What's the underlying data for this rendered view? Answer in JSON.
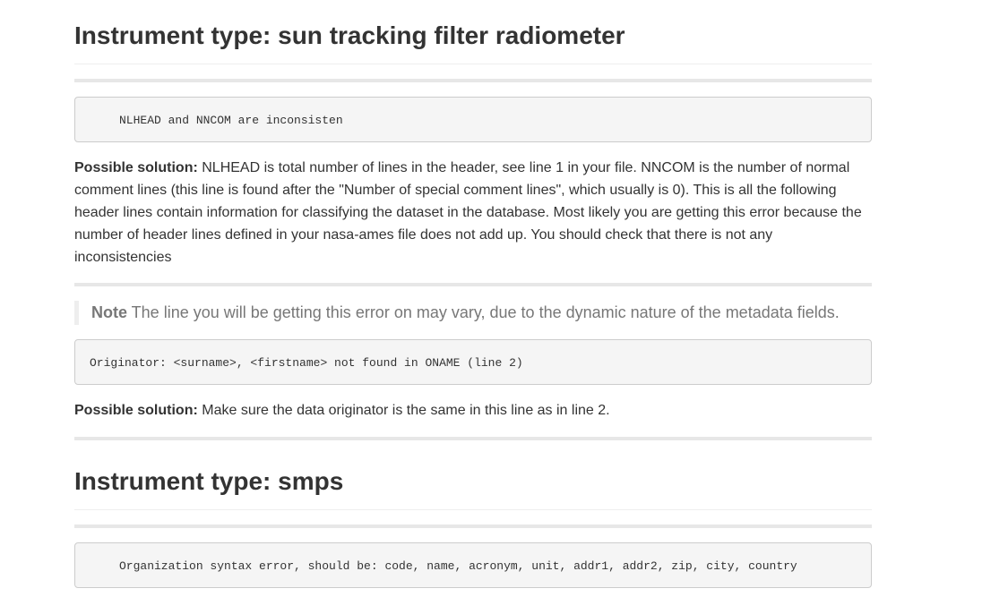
{
  "section1": {
    "heading": "Instrument type: sun tracking filter radiometer",
    "code1": "NLHEAD and NNCOM are inconsisten",
    "solution1_label": "Possible solution:",
    "solution1_text": " NLHEAD is total number of lines in the header, see line 1 in your file. NNCOM is the number of normal comment lines (this line is found after the \"Number of special comment lines\", which usually is 0). This is all the following header lines contain information for classifying the dataset in the database. Most likely you are getting this error because the number of header lines defined in your nasa-ames file does not add up. You should check that there is not any inconsistencies",
    "note_label": "Note",
    "note_text": " The line you will be getting this error on may vary, due to the dynamic nature of the metadata fields.",
    "code2": "Originator: <surname>, <firstname> not found in ONAME (line 2)",
    "solution2_label": "Possible solution:",
    "solution2_text": " Make sure the data originator is the same in this line as in line 2."
  },
  "section2": {
    "heading": "Instrument type: smps",
    "code1": "Organization syntax error, should be: code, name, acronym, unit, addr1, addr2, zip, city, country"
  }
}
